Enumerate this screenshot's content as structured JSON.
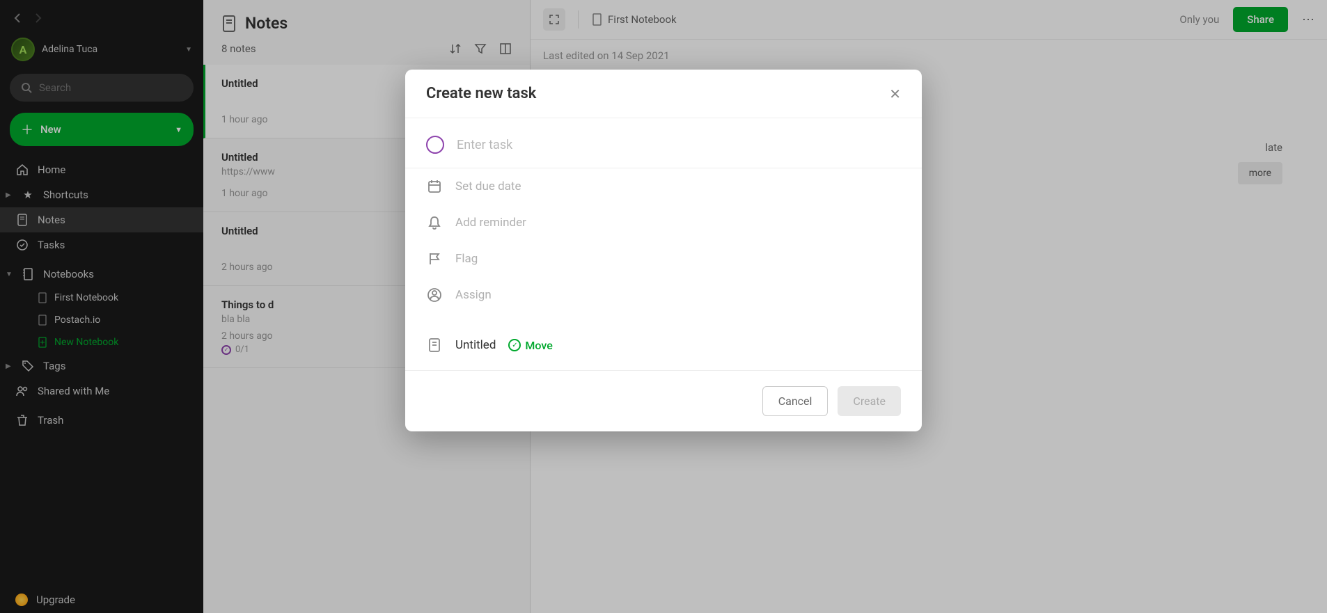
{
  "sidebar": {
    "user": {
      "initial": "A",
      "name": "Adelina Tuca"
    },
    "search_placeholder": "Search",
    "new_label": "New",
    "items": {
      "home": "Home",
      "shortcuts": "Shortcuts",
      "notes": "Notes",
      "tasks": "Tasks",
      "notebooks": "Notebooks",
      "tags": "Tags",
      "shared": "Shared with Me",
      "trash": "Trash",
      "upgrade": "Upgrade"
    },
    "notebooks_children": [
      {
        "label": "First Notebook"
      },
      {
        "label": "Postach.io"
      },
      {
        "label": "New Notebook"
      }
    ]
  },
  "list": {
    "title": "Notes",
    "count": "8 notes",
    "items": [
      {
        "title": "Untitled",
        "preview": "",
        "time": "1 hour ago"
      },
      {
        "title": "Untitled",
        "preview": "https://www",
        "time": "1 hour ago"
      },
      {
        "title": "Untitled",
        "preview": "",
        "time": "2 hours ago"
      },
      {
        "title": "Things to d",
        "preview": "bla bla",
        "time": "2 hours ago",
        "progress": "0/1"
      }
    ]
  },
  "editor": {
    "notebook": "First Notebook",
    "only_you": "Only you",
    "share": "Share",
    "last_edited": "Last edited on 14 Sep 2021",
    "template_hint": "late",
    "more_badge": "more"
  },
  "modal": {
    "title": "Create new task",
    "task_placeholder": "Enter task",
    "due_date": "Set due date",
    "reminder": "Add reminder",
    "flag": "Flag",
    "assign": "Assign",
    "note_name": "Untitled",
    "move": "Move",
    "cancel": "Cancel",
    "create": "Create"
  }
}
